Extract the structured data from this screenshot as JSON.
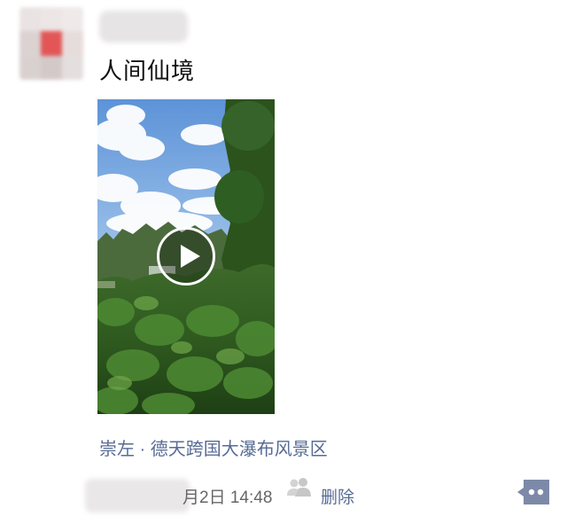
{
  "post": {
    "text": "人间仙境",
    "location": "崇左 · 德天跨国大瀑布风景区"
  },
  "footer": {
    "time": "月2日 14:48",
    "delete_label": "删除"
  },
  "colors": {
    "link": "#576b95",
    "more_button": "#7c8aa8"
  },
  "icons": {
    "play": "play-icon",
    "visibility": "people-icon",
    "more": "comment-more-icon"
  }
}
